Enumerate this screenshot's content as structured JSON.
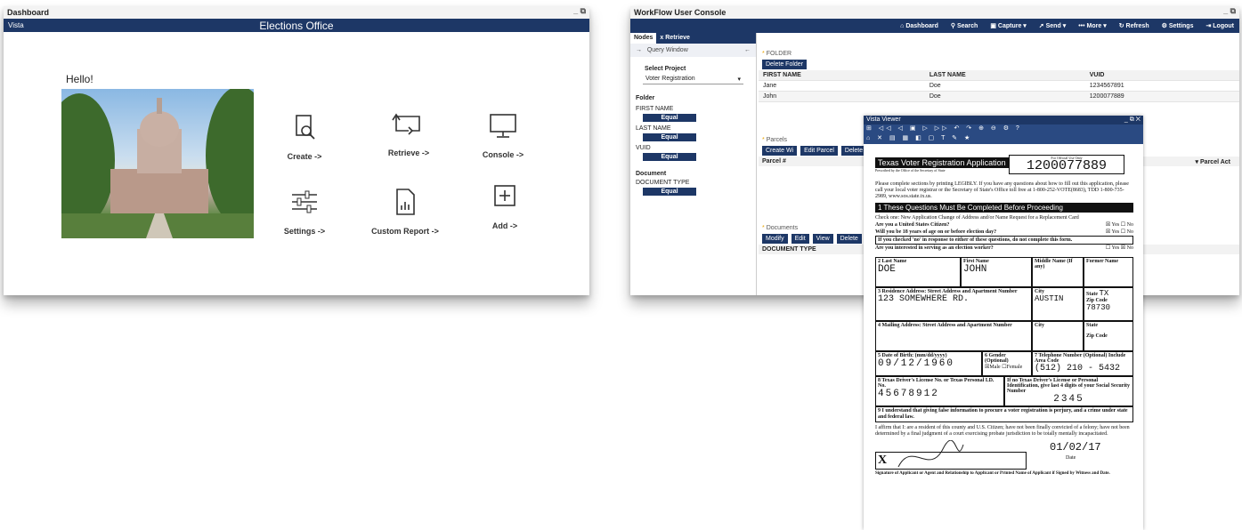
{
  "dashboard": {
    "window_title": "Dashboard",
    "bar_left": "Vista",
    "bar_title": "Elections Office",
    "hello": "Hello!",
    "tiles": [
      {
        "label": "Create ->",
        "icon": "search-document-icon"
      },
      {
        "label": "Retrieve ->",
        "icon": "retrieve-icon"
      },
      {
        "label": "Console ->",
        "icon": "monitor-icon"
      },
      {
        "label": "Settings ->",
        "icon": "sliders-icon"
      },
      {
        "label": "Custom Report ->",
        "icon": "report-icon"
      },
      {
        "label": "Add ->",
        "icon": "plus-box-icon"
      }
    ]
  },
  "workflow": {
    "window_title": "WorkFlow User Console",
    "menu": [
      "Dashboard",
      "Search",
      "Capture",
      "Send",
      "More",
      "Refresh",
      "Settings",
      "Logout"
    ],
    "tabs": {
      "nodes": "Nodes",
      "retrieve": "Retrieve"
    },
    "query_window": "Query Window",
    "select_project": "Select Project",
    "project_value": "Voter Registration",
    "folder": "Folder",
    "first_name": "FIRST NAME",
    "last_name": "LAST NAME",
    "vuid": "VUID",
    "equal": "Equal",
    "document": "Document",
    "document_type": "DOCUMENT TYPE",
    "folder_section": "FOLDER",
    "delete_folder": "Delete Folder",
    "folder_cols": [
      "FIRST NAME",
      "LAST NAME",
      "VUID"
    ],
    "folder_rows": [
      [
        "Jane",
        "Doe",
        "1234567891"
      ],
      [
        "John",
        "Doe",
        "1200077889"
      ]
    ],
    "parcels": "Parcels",
    "parcel_buttons": [
      "Create Wi",
      "Edit Parcel",
      "Delete"
    ],
    "parcel_col": "Parcel #",
    "parcel_act": "Parcel Act",
    "documents": "Documents",
    "doc_buttons": [
      "Modify",
      "Edit",
      "View",
      "Delete"
    ],
    "doc_col": "DOCUMENT TYPE"
  },
  "viewer": {
    "title": "Vista Viewer",
    "form_title": "Texas Voter Registration Application",
    "form_sub": "Prescribed by the Office of the Secretary of State",
    "office_use": "For Official Use Only",
    "vuid_hand": "1200077889",
    "intro": "Please complete sections by printing LEGIBLY. If you have any questions about how to fill out this application, please call your local voter registrar or the Secretary of State's Office toll free at 1-800-252-VOTE(8683), TDD 1-800-735-2989, www.sos.state.tx.us.",
    "sec1": "1  These Questions Must Be Completed Before Proceeding",
    "check_line": "Check one: New Application  Change of Address and/or Name  Request for a Replacement Card",
    "q1": "Are you a United States Citizen?",
    "q2": "Will you be 18 years of age on or before election day?",
    "q3": "If you checked 'no' in response to either of these questions, do not complete this form.",
    "q4": "Are you interested in serving as an election worker?",
    "yes": "Yes",
    "no": "No",
    "last_label": "Last Name",
    "first_label": "First Name",
    "middle_label": "Middle Name (If any)",
    "former_label": "Former Name",
    "last_val": "DOE",
    "first_val": "JOHN",
    "res_label": "Residence Address: Street Address and Apartment Number",
    "city_label": "City",
    "state_label": "State",
    "zip_label": "Zip Code",
    "res_val": "123 SOMEWHERE RD.",
    "city_val": "AUSTIN",
    "state_val": "TX",
    "zip_val": "78730",
    "mail_label": "Mailing Address: Street Address and Apartment Number",
    "dob_label": "Date of Birth: (mm/dd/yyyy)",
    "dob_val": "09/12/1960",
    "gender_label": "Gender (Optional)",
    "male": "Male",
    "female": "Female",
    "phone_label": "Telephone Number (Optional) Include Area Code",
    "phone_val": "(512) 210 - 5432",
    "dl_label": "Texas Driver's License No. or Texas Personal I.D. No.",
    "dl_val": "45678912",
    "ssn_label": "If no Texas Driver's License or Personal Identification, give last 4 digits of your Social Security Number",
    "ssn_val": "2345",
    "sec9": "I understand that giving false information to procure a voter registration is perjury, and a crime under state and federal law.",
    "affirm": "I affirm that I: are a resident of this county and U.S. Citizen; have not been finally convicted of a felony; have not been determined by a final judgment of a court exercising probate jurisdiction to be totally mentally incapacitated.",
    "date_val": "01/02/17",
    "date_label": "Date",
    "sig_label": "Signature of Applicant or Agent and Relationship to Applicant or Printed Name of Applicant if Signed by Witness and Date."
  }
}
